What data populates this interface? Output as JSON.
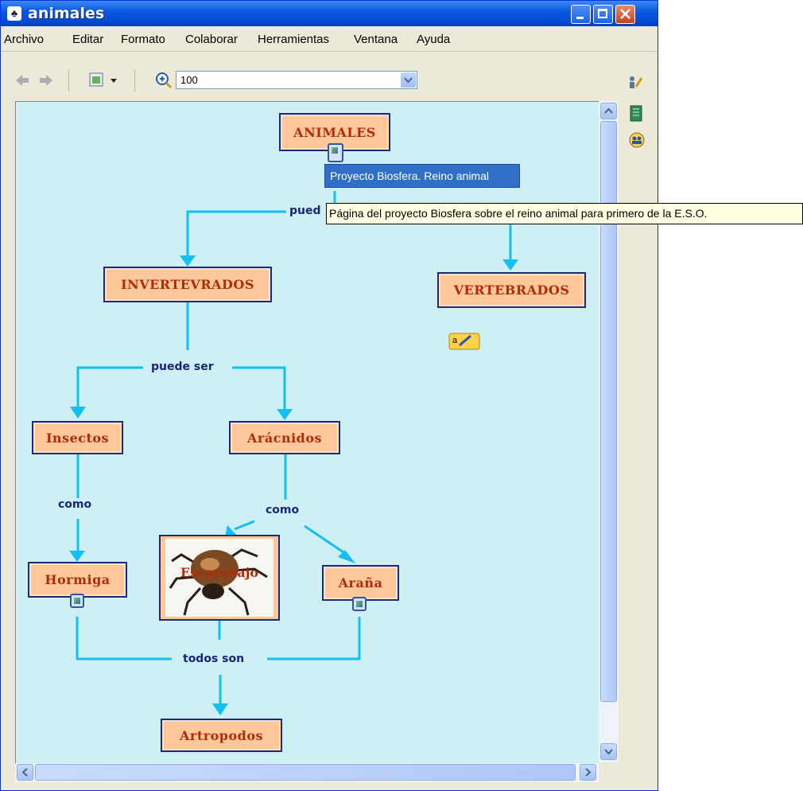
{
  "window": {
    "title": "animales"
  },
  "menu": [
    "Archivo",
    "Editar",
    "Formato",
    "Colaborar",
    "Herramientas",
    "Ventana",
    "Ayuda"
  ],
  "toolbar": {
    "zoom_value": "100"
  },
  "tooltips": {
    "resource_title": "Proyecto Biosfera. Reino animal",
    "resource_description": "Página del proyecto Biosfera sobre el reino animal para primero de la E.S.O."
  },
  "map": {
    "concepts": {
      "animales": "ANIMALES",
      "invertebrados": "INVERTEVRADOS",
      "vertebrados": "VERTEBRADOS",
      "insectos": "Insectos",
      "aracnidos": "Arácnidos",
      "hormiga": "Hormiga",
      "escarabajo": "Escarabajo",
      "arana": "Araña",
      "artropodos": "Artropodos"
    },
    "links": {
      "top": "pued",
      "puede_ser": "puede ser",
      "como_left": "como",
      "como_right": "como",
      "todos_son": "todos son"
    }
  },
  "icons": {
    "nav_back": "back-arrow-icon",
    "nav_forward": "forward-arrow-icon",
    "view": "view-menu-icon",
    "zoom": "zoom-icon",
    "collaborate": "collaborate-icon",
    "book": "book-icon",
    "users": "users-icon",
    "note": "annotation-icon"
  },
  "colors": {
    "canvas": "#cef0f5",
    "concept_fill": "#ffc89a",
    "concept_text": "#b12a0a",
    "line": "#15c0f0",
    "link_text": "#1a237e"
  }
}
